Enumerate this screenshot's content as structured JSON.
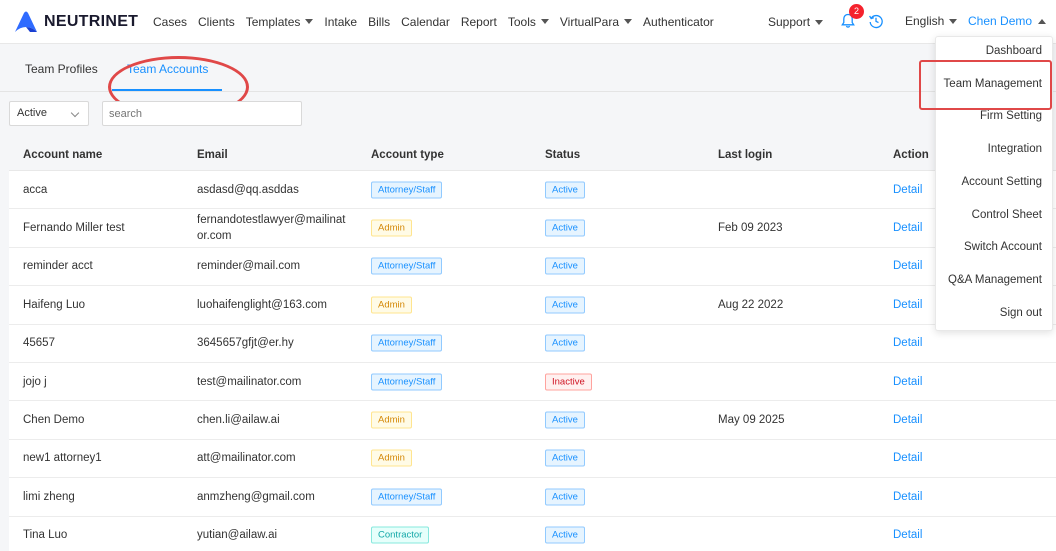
{
  "brand": {
    "name": "NEUTRINET",
    "accent": "#1890ff"
  },
  "nav": {
    "items": [
      {
        "label": "Cases",
        "dropdown": false
      },
      {
        "label": "Clients",
        "dropdown": false
      },
      {
        "label": "Templates",
        "dropdown": true
      },
      {
        "label": "Intake",
        "dropdown": false
      },
      {
        "label": "Bills",
        "dropdown": false
      },
      {
        "label": "Calendar",
        "dropdown": false
      },
      {
        "label": "Report",
        "dropdown": false
      },
      {
        "label": "Tools",
        "dropdown": true
      },
      {
        "label": "VirtualPara",
        "dropdown": true
      },
      {
        "label": "Authenticator",
        "dropdown": false
      }
    ],
    "support": "Support",
    "notification_count": "2",
    "language": "English",
    "user": "Chen Demo"
  },
  "tabs": [
    {
      "label": "Team Profiles",
      "active": false
    },
    {
      "label": "Team Accounts",
      "active": true
    }
  ],
  "filters": {
    "status_value": "Active",
    "search_placeholder": "search"
  },
  "table": {
    "columns": [
      "Account name",
      "Email",
      "Account type",
      "Status",
      "Last login",
      "Action"
    ],
    "rows": [
      {
        "name": "acca",
        "email": "asdasd@qq.asddas",
        "type": "Attorney/Staff",
        "status": "Active",
        "last_login": "",
        "action": "Detail"
      },
      {
        "name": "Fernando Miller test",
        "email": "fernandotestlawyer@mailinator.com",
        "type": "Admin",
        "status": "Active",
        "last_login": "Feb 09 2023",
        "action": "Detail"
      },
      {
        "name": "reminder acct",
        "email": "reminder@mail.com",
        "type": "Attorney/Staff",
        "status": "Active",
        "last_login": "",
        "action": "Detail"
      },
      {
        "name": "Haifeng Luo",
        "email": "luohaifenglight@163.com",
        "type": "Admin",
        "status": "Active",
        "last_login": "Aug 22 2022",
        "action": "Detail"
      },
      {
        "name": "45657",
        "email": "3645657gfjt@er.hy",
        "type": "Attorney/Staff",
        "status": "Active",
        "last_login": "",
        "action": "Detail"
      },
      {
        "name": "jojo j",
        "email": "test@mailinator.com",
        "type": "Attorney/Staff",
        "status": "Inactive",
        "last_login": "",
        "action": "Detail"
      },
      {
        "name": "Chen Demo",
        "email": "chen.li@ailaw.ai",
        "type": "Admin",
        "status": "Active",
        "last_login": "May 09 2025",
        "action": "Detail"
      },
      {
        "name": "new1 attorney1",
        "email": "att@mailinator.com",
        "type": "Admin",
        "status": "Active",
        "last_login": "",
        "action": "Detail"
      },
      {
        "name": "limi zheng",
        "email": "anmzheng@gmail.com",
        "type": "Attorney/Staff",
        "status": "Active",
        "last_login": "",
        "action": "Detail"
      },
      {
        "name": "Tina Luo",
        "email": "yutian@ailaw.ai",
        "type": "Contractor",
        "status": "Active",
        "last_login": "",
        "action": "Detail"
      }
    ]
  },
  "user_menu": {
    "items": [
      "Dashboard",
      "Team Management",
      "Firm Setting",
      "Integration",
      "Account Setting",
      "Control Sheet",
      "Switch Account",
      "Q&A Management",
      "Sign out"
    ]
  }
}
